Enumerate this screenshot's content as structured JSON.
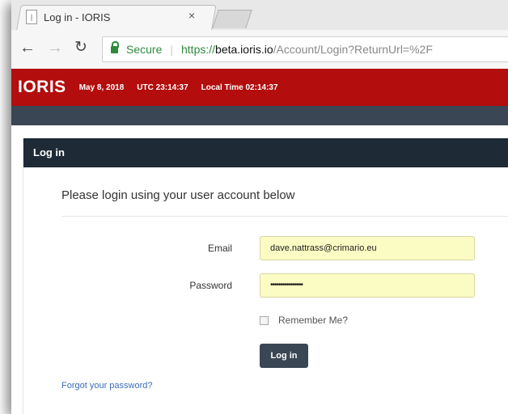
{
  "browser": {
    "tab_title": "Log in - IORIS",
    "tab_close": "×",
    "security_label": "Secure",
    "url_scheme": "https://",
    "url_host": "beta.ioris.io",
    "url_path": "/Account/Login?ReturnUrl=%2F"
  },
  "header": {
    "logo": "IORIS",
    "date": "May 8, 2018",
    "utc_time": "UTC 23:14:37",
    "local_time": "Local Time 02:14:37",
    "brand_color": "#b30d0d"
  },
  "panel": {
    "title": "Log in",
    "intro": "Please login using your user account below",
    "email_label": "Email",
    "email_value": "dave.nattrass@crimario.eu",
    "password_label": "Password",
    "password_value": "••••••••••••••••",
    "remember_label": "Remember Me?",
    "login_button": "Log in",
    "forgot_link": "Forgot your password?"
  }
}
